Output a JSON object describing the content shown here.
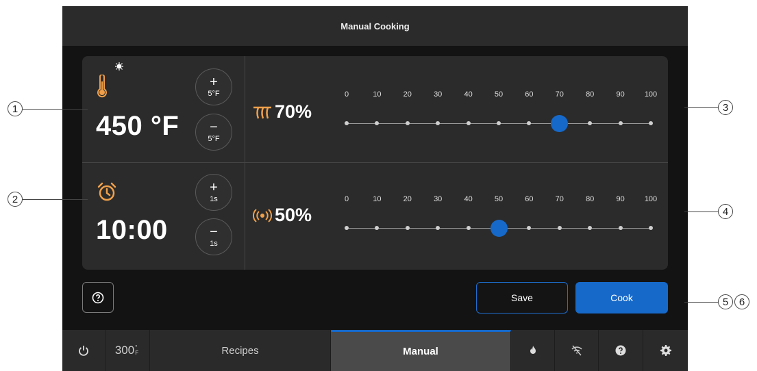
{
  "window": {
    "title": "Manual Cooking"
  },
  "temperature": {
    "value": "450 °F",
    "increase_symbol": "+",
    "increase_step": "5°F",
    "decrease_symbol": "−",
    "decrease_step": "5°F"
  },
  "timer": {
    "value": "10:00",
    "increase_symbol": "+",
    "increase_step": "1s",
    "decrease_symbol": "−",
    "decrease_step": "1s"
  },
  "heat_power": {
    "label": "70%",
    "value": 70,
    "ticks": [
      "0",
      "10",
      "20",
      "30",
      "40",
      "50",
      "60",
      "70",
      "80",
      "90",
      "100"
    ]
  },
  "microwave_power": {
    "label": "50%",
    "value": 50,
    "ticks": [
      "0",
      "10",
      "20",
      "30",
      "40",
      "50",
      "60",
      "70",
      "80",
      "90",
      "100"
    ]
  },
  "actions": {
    "save_label": "Save",
    "cook_label": "Cook"
  },
  "nav": {
    "temp_label": "300",
    "temp_unit": "°F",
    "recipes_label": "Recipes",
    "manual_label": "Manual"
  },
  "callouts": {
    "c1": "1",
    "c2": "2",
    "c3": "3",
    "c4": "4",
    "c5": "5",
    "c6": "6"
  },
  "colors": {
    "accent": "#1669c9",
    "icon_orange": "#f0a04a",
    "background": "#131313",
    "panel": "#2b2b2b"
  },
  "icons": [
    "thermometer-icon",
    "alarm-clock-icon",
    "heating-element-icon",
    "microwave-icon",
    "help-icon",
    "power-icon",
    "flame-icon",
    "wifi-off-icon",
    "question-icon",
    "gear-icon"
  ]
}
